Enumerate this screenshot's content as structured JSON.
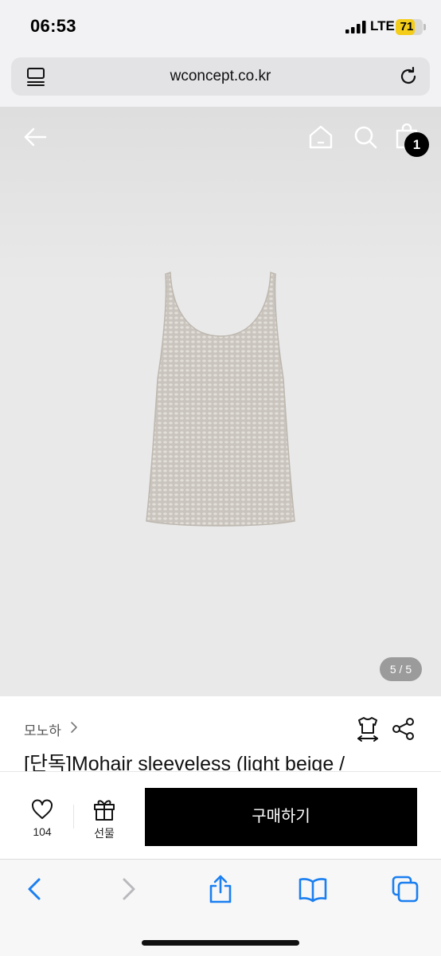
{
  "status_bar": {
    "time": "06:53",
    "network": "LTE",
    "battery": "71",
    "battery_level": 0.71
  },
  "browser": {
    "url": "wconcept.co.kr",
    "reader_icon": "reader-mode-icon",
    "reload_icon": "reload-icon"
  },
  "header": {
    "back_icon": "back-arrow-icon",
    "home_icon": "home-icon",
    "search_icon": "search-icon",
    "bag_icon": "shopping-bag-icon",
    "cart_count": "1"
  },
  "gallery": {
    "counter": "5 / 5",
    "current": 5,
    "total": 5
  },
  "product": {
    "brand": "모노하",
    "title": "[단독]Mohair sleeveless (light beige /",
    "size_icon": "size-guide-icon",
    "share_icon": "share-icon"
  },
  "purchase_bar": {
    "like_count": "104",
    "gift_label": "선물",
    "buy_label": "구매하기"
  },
  "toolbar": {
    "items": [
      "back-icon",
      "forward-icon",
      "share-icon",
      "bookmarks-icon",
      "tabs-icon"
    ]
  },
  "colors": {
    "accent": "#1a7ff0",
    "buy_button": "#000000",
    "battery": "#f4cd1b"
  }
}
